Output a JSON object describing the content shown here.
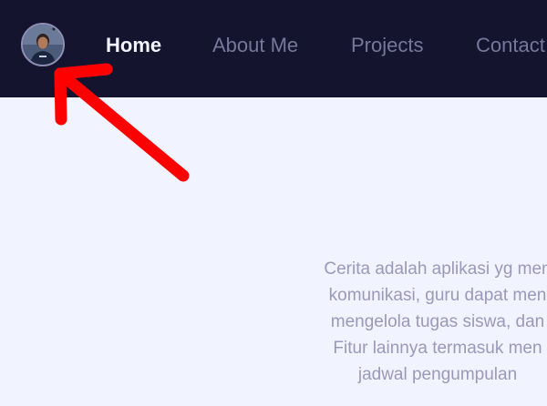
{
  "navbar": {
    "avatar_alt": "profile photo",
    "items": [
      {
        "label": "Home",
        "active": true
      },
      {
        "label": "About Me",
        "active": false
      },
      {
        "label": "Projects",
        "active": false
      },
      {
        "label": "Contact",
        "active": false
      }
    ]
  },
  "main": {
    "description_lines": [
      "Cerita adalah aplikasi yg men",
      "komunikasi, guru dapat men",
      "mengelola tugas siswa, dan",
      "Fitur lainnya termasuk men",
      "jadwal pengumpulan"
    ]
  },
  "annotation": {
    "arrow_color": "#ff0000",
    "target": "avatar"
  },
  "colors": {
    "navbar_bg": "#14142f",
    "page_bg": "#f1f3fe",
    "nav_active": "#f2f3ff",
    "nav_inactive": "#77779a",
    "body_text": "#9a99ba"
  }
}
